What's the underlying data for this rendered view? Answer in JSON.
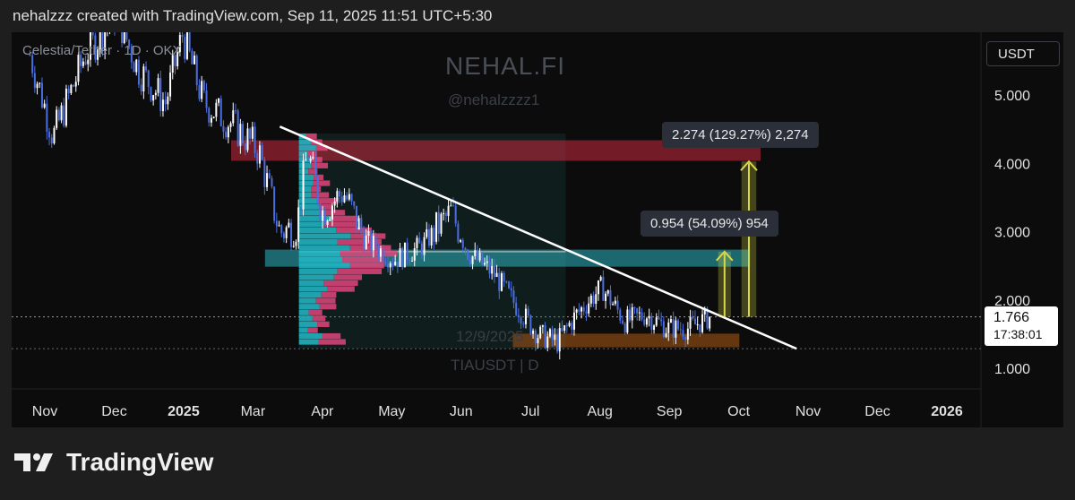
{
  "header": {
    "text": "nehalzzz created with TradingView.com, Sep 11, 2025 11:51 UTC+5:30"
  },
  "symbol": {
    "text": "Celestia/Tether · 1D · OKX"
  },
  "watermark": {
    "brand": "NEHAL.FI",
    "handle": "@nehalzzzz1",
    "date": "12/9/2025",
    "ticker": "TIAUSDT | D"
  },
  "currency_button": {
    "label": "USDT"
  },
  "price_tag": {
    "price": "1.766",
    "countdown": "17:38:01"
  },
  "measure_tags": {
    "big": "2.274 (129.27%) 2,274",
    "small": "0.954 (54.09%) 954"
  },
  "brand": {
    "name": "TradingView"
  },
  "colors": {
    "candle": "#4a6ee0",
    "trendline": "#ffffff",
    "resistance_zone": "#b3263a",
    "support_zone": "#2aa7b0",
    "demand_zone": "#8a4a12",
    "target_arrow": "#d9d94a",
    "vp_upper": "#e0457a",
    "vp_lower": "#22b8c8"
  },
  "chart_data": {
    "type": "candlestick",
    "symbol": "TIAUSDT",
    "interval": "1D",
    "x_axis": {
      "ticks": [
        "Nov",
        "Dec",
        "2025",
        "Mar",
        "Apr",
        "May",
        "Jun",
        "Jul",
        "Aug",
        "Sep",
        "Oct",
        "Nov",
        "Dec",
        "2026"
      ]
    },
    "y_axis": {
      "ticks": [
        "5.000",
        "4.000",
        "3.000",
        "2.000",
        "1.000"
      ],
      "range": [
        0.75,
        5.75
      ]
    },
    "last_price": 1.766,
    "price_path": [
      {
        "t": "2024-10-25",
        "p": 5.6
      },
      {
        "t": "2024-11-05",
        "p": 4.4
      },
      {
        "t": "2024-11-20",
        "p": 5.6
      },
      {
        "t": "2024-12-05",
        "p": 6.2
      },
      {
        "t": "2024-12-15",
        "p": 5.4
      },
      {
        "t": "2024-12-28",
        "p": 4.9
      },
      {
        "t": "2025-01-05",
        "p": 5.9
      },
      {
        "t": "2025-01-15",
        "p": 4.9
      },
      {
        "t": "2025-01-28",
        "p": 4.6
      },
      {
        "t": "2025-02-10",
        "p": 4.2
      },
      {
        "t": "2025-02-20",
        "p": 3.0
      },
      {
        "t": "2025-02-28",
        "p": 3.1
      },
      {
        "t": "2025-03-05",
        "p": 4.2
      },
      {
        "t": "2025-03-12",
        "p": 3.3
      },
      {
        "t": "2025-03-22",
        "p": 3.6
      },
      {
        "t": "2025-04-01",
        "p": 2.9
      },
      {
        "t": "2025-04-15",
        "p": 2.6
      },
      {
        "t": "2025-04-28",
        "p": 2.8
      },
      {
        "t": "2025-05-12",
        "p": 3.3
      },
      {
        "t": "2025-05-20",
        "p": 2.7
      },
      {
        "t": "2025-06-01",
        "p": 2.4
      },
      {
        "t": "2025-06-10",
        "p": 2.0
      },
      {
        "t": "2025-06-22",
        "p": 1.5
      },
      {
        "t": "2025-07-01",
        "p": 1.4
      },
      {
        "t": "2025-07-10",
        "p": 1.8
      },
      {
        "t": "2025-07-22",
        "p": 2.2
      },
      {
        "t": "2025-08-02",
        "p": 1.7
      },
      {
        "t": "2025-08-12",
        "p": 1.8
      },
      {
        "t": "2025-08-22",
        "p": 1.6
      },
      {
        "t": "2025-09-01",
        "p": 1.6
      },
      {
        "t": "2025-09-11",
        "p": 1.766
      }
    ],
    "zones": [
      {
        "name": "resistance",
        "from": 4.05,
        "to": 4.35
      },
      {
        "name": "support",
        "from": 2.5,
        "to": 2.75
      },
      {
        "name": "demand",
        "from": 1.32,
        "to": 1.52
      }
    ],
    "trendline": {
      "from": {
        "t": "2025-02-20",
        "p": 4.55
      },
      "to": {
        "t": "2025-10-22",
        "p": 1.3
      }
    },
    "targets": [
      {
        "label": "0.954 (54.09%) 954",
        "from": 1.766,
        "to": 2.72
      },
      {
        "label": "2.274 (129.27%) 2,274",
        "from": 1.766,
        "to": 4.04
      }
    ]
  }
}
